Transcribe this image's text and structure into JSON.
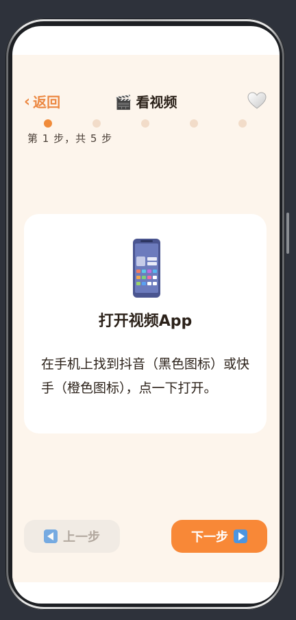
{
  "header": {
    "back_label": "返回",
    "title_icon": "clapper-board-icon",
    "title_emoji": "🎬",
    "title": "看视频",
    "favorite_icon": "heart-icon"
  },
  "progress": {
    "total_steps": 5,
    "current_step": 1,
    "label": "第 1 步，共 5 步"
  },
  "card": {
    "icon": "mobile-phone-icon",
    "title": "打开视频App",
    "body": "在手机上找到抖音（黑色图标）或快手（橙色图标），点一下打开。"
  },
  "buttons": {
    "prev_label": "上一步",
    "next_label": "下一步"
  },
  "colors": {
    "accent": "#f88837",
    "background": "#fdf5ec",
    "dot_inactive": "#f2dcc9",
    "prev_button": "#f1ebe4"
  }
}
